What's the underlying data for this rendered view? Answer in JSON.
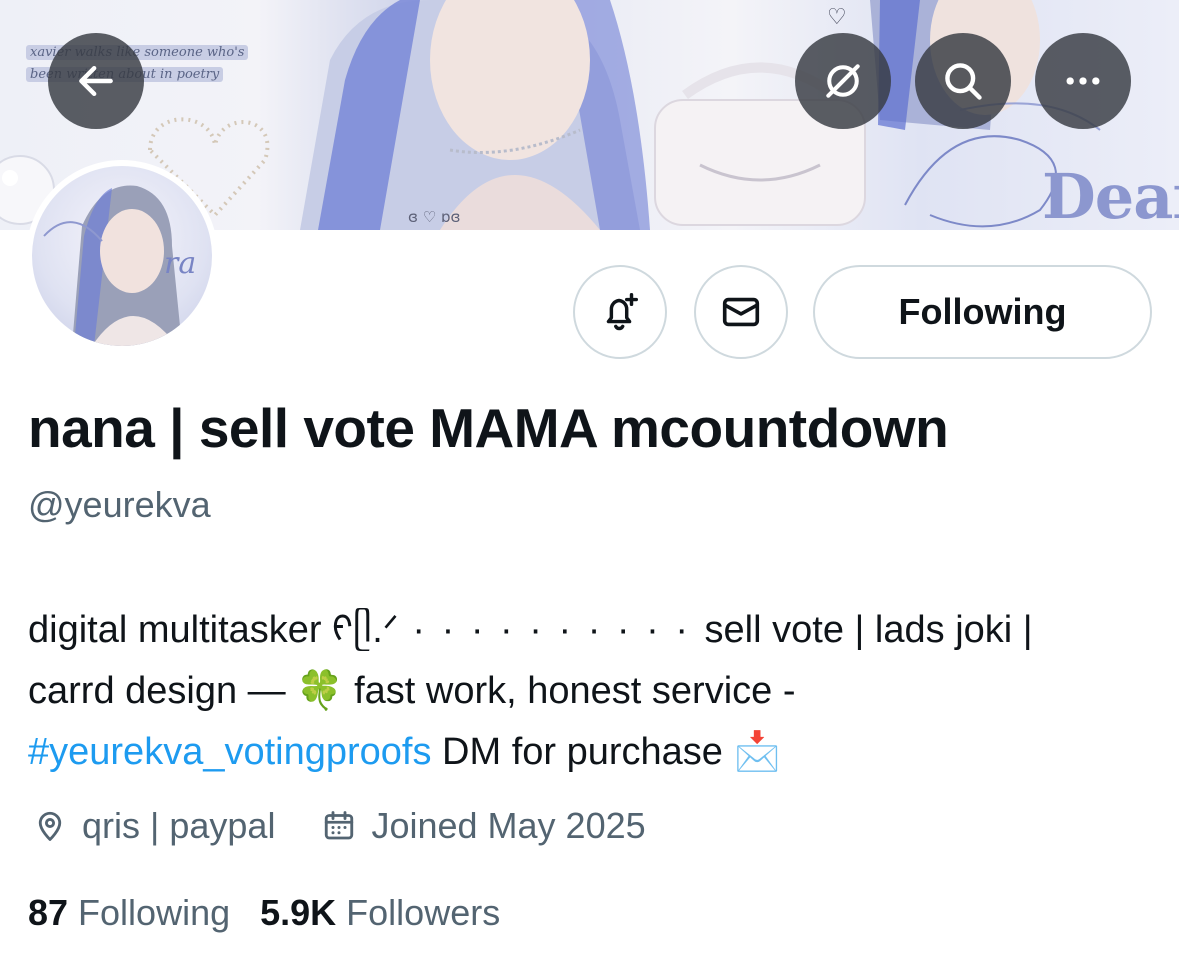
{
  "banner": {
    "caption_line1": "xavier walks like someone who's",
    "caption_line2": "been written about in poetry",
    "signature": "Dean",
    "center_text": "ɞ ♡ ɒɞ",
    "heart_small": "♡"
  },
  "avatar": {
    "overlay_text": "ra"
  },
  "top_buttons": {
    "back_icon": "arrow-left-icon",
    "grok_icon": "grok-icon",
    "search_icon": "search-icon",
    "more_icon": "more-horizontal-icon"
  },
  "actions": {
    "notify_icon": "bell-plus-icon",
    "message_icon": "envelope-icon",
    "following_label": "Following"
  },
  "profile": {
    "display_name": "nana | sell vote MAMA mcountdown",
    "handle": "@yeurekva",
    "bio_line1_a": "digital multitasker ᠻ",
    "bio_line1_b": "ᥫ.ᐟ",
    "bio_line1_dots": " · · · · · · · · · · ",
    "bio_line1_c": "sell vote | lads joki |",
    "bio_line2": "carrd design — 🍀 fast work, honest service -",
    "bio_hashtag": "#yeurekva_votingproofs",
    "bio_line3_rest": " DM for purchase 📩",
    "location": "qris | paypal",
    "joined": "Joined May 2025",
    "following_count": "87",
    "following_label": "Following",
    "followers_count": "5.9K",
    "followers_label": "Followers"
  },
  "colors": {
    "text_primary": "#0f1419",
    "text_secondary": "#536471",
    "link": "#1d9bf0",
    "border": "#cfd9de"
  }
}
